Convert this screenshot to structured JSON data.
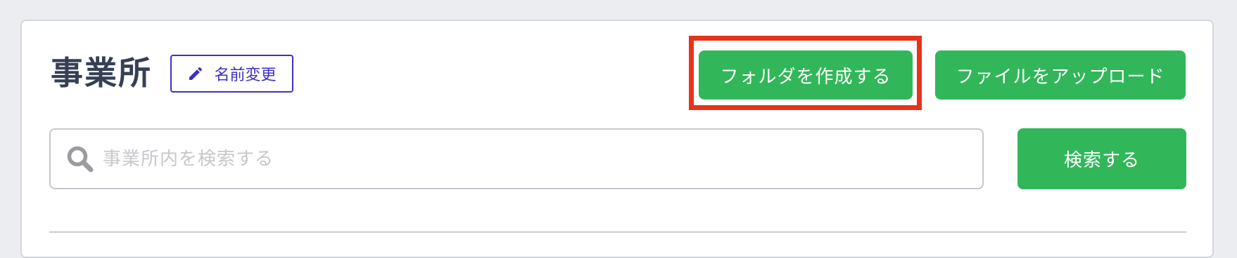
{
  "header": {
    "title": "事業所",
    "rename_label": "名前変更"
  },
  "toolbar": {
    "create_folder_label": "フォルダを作成する",
    "upload_file_label": "ファイルをアップロード"
  },
  "search": {
    "placeholder": "事業所内を検索する",
    "value": "",
    "button_label": "検索する"
  },
  "icons": {
    "rename": "pencil-icon",
    "search": "search-icon"
  },
  "colors": {
    "primary_green": "#31b75a",
    "accent_indigo": "#3b30c7",
    "highlight_red": "#e8321c",
    "title_text": "#363f55"
  }
}
